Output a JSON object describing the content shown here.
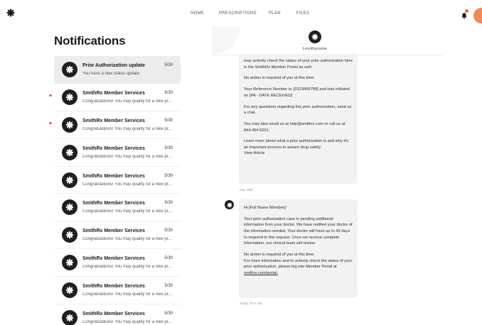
{
  "nav": {
    "items": [
      {
        "label": "HOME"
      },
      {
        "label": "PRESCRIPTIONS"
      },
      {
        "label": "PLAN"
      },
      {
        "label": "FILES"
      }
    ]
  },
  "page_title": "Notifications",
  "notifications": [
    {
      "title": "Prior Authorization update",
      "date": "5/30",
      "preview": "You have a new status update",
      "selected": true,
      "unread": false
    },
    {
      "title": "SmithRx Member Services",
      "date": "5/30",
      "preview": "Congratulations! You may qualify for a new pr...",
      "selected": false,
      "unread": true
    },
    {
      "title": "SmithRx Member Services",
      "date": "5/30",
      "preview": "Congratulations! You may qualify for a new pr...",
      "selected": false,
      "unread": true
    },
    {
      "title": "SmithRx Member Services",
      "date": "5/30",
      "preview": "Congratulations! You may qualify for a new pr...",
      "selected": false,
      "unread": false
    },
    {
      "title": "SmithRx Member Services",
      "date": "5/30",
      "preview": "Congratulations! You may qualify for a new pr...",
      "selected": false,
      "unread": false
    },
    {
      "title": "SmithRx Member Services",
      "date": "5/30",
      "preview": "Congratulations! You may qualify for a new pr...",
      "selected": false,
      "unread": false
    },
    {
      "title": "SmithRx Member Services",
      "date": "5/30",
      "preview": "Congratulations! You may qualify for a new pr...",
      "selected": false,
      "unread": false
    },
    {
      "title": "SmithRx Member Services",
      "date": "5/30",
      "preview": "Congratulations! You may qualify for a new pr...",
      "selected": false,
      "unread": false
    },
    {
      "title": "SmithRx Member Services",
      "date": "5/30",
      "preview": "Congratulations! You may qualify for a new pr...",
      "selected": false,
      "unread": false
    },
    {
      "title": "SmithRx Member Services",
      "date": "5/30",
      "preview": "Congratulations! You may qualify for a new pr...",
      "selected": false,
      "unread": false
    }
  ],
  "detail": {
    "header_name": "Levothyroxine",
    "message1": {
      "paragraphs": [
        "may actively check the status of your prior authorization here in the SmithRx Member Portal as well.",
        "No action is required of you at this time.",
        "Your Reference Number is: [0123456789] and was initiated on [PA - DATE RECEIVED]",
        "For any questions regarding this prior authorization, send us a chat.",
        "You may also email us at help@smithrx.com or call us at 844.454.5201.",
        "Learn more about what a prior authorization is and why it's an important process to assure drug safety."
      ],
      "link": "View Article",
      "timestamp": "May 29th"
    },
    "message2": {
      "greeting": "Hi [Full Name Member]!",
      "body": "Your prior authorization case is pending additional information from your doctor. We have notified your doctor of the information needed. Your doctor will have up to 45 days to respond to this request. Once we receive complete information, our clinical team will review.",
      "closing": "No action is required of you at this time.",
      "more_info": "For more information and to actively check the status of your prior authorization, please log into Member Portal at",
      "link": "smithrx.com/portal.",
      "timestamp": "Today, 9:57 AM"
    }
  },
  "colors": {
    "accent": "#f2683a",
    "avatar": "#f08a5a",
    "icon_bg": "#1f1f1f"
  }
}
